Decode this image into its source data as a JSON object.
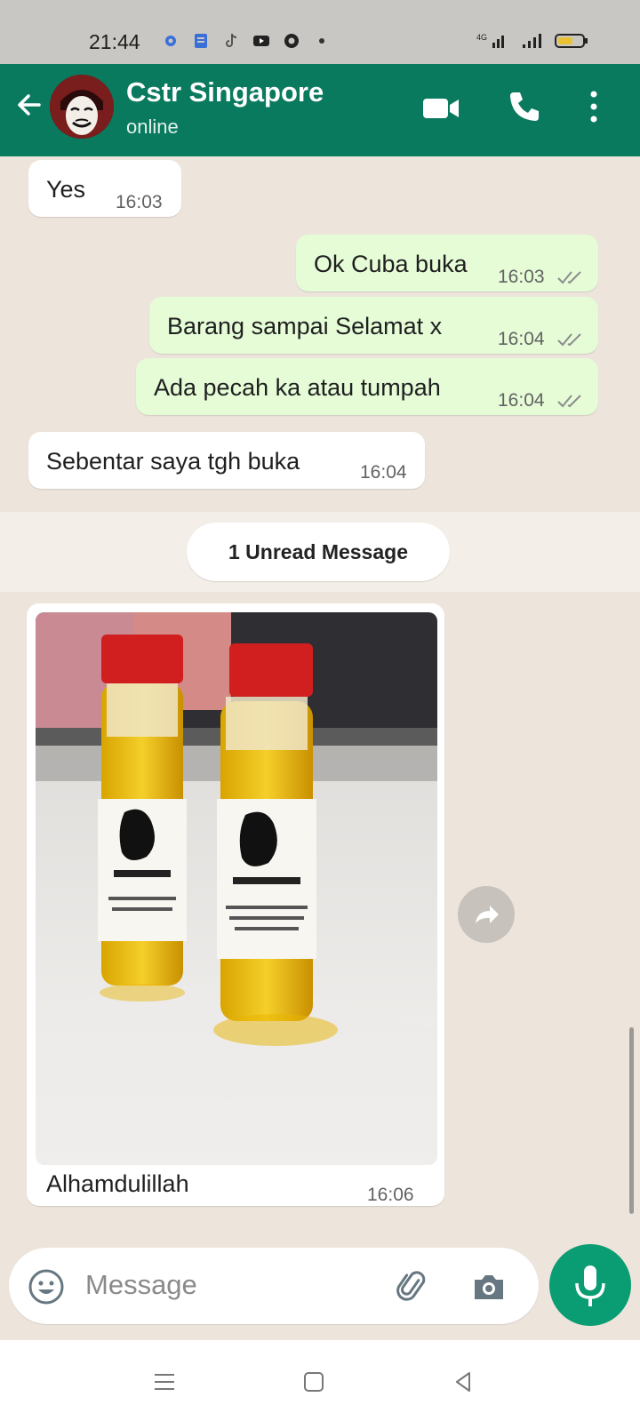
{
  "status_bar": {
    "time": "21:44",
    "network": "4G"
  },
  "header": {
    "contact_name": "Cstr Singapore",
    "status": "online"
  },
  "messages": [
    {
      "dir": "in",
      "text": "Yes",
      "time": "16:03"
    },
    {
      "dir": "out",
      "text": "Ok Cuba buka",
      "time": "16:03"
    },
    {
      "dir": "out",
      "text": "Barang sampai Selamat x",
      "time": "16:04"
    },
    {
      "dir": "out",
      "text": "Ada pecah ka atau tumpah",
      "time": "16:04"
    },
    {
      "dir": "in",
      "text": "Sebentar saya tgh buka",
      "time": "16:04"
    }
  ],
  "unread_label": "1 Unread Message",
  "photo_message": {
    "caption": "Alhamdulillah",
    "time": "16:06",
    "image_subject": "two bottles of yellow oil with red caps"
  },
  "input": {
    "placeholder": "Message"
  },
  "colors": {
    "header": "#0a7a5f",
    "outgoing_bubble": "#e5fcd7",
    "incoming_bubble": "#ffffff",
    "mic_button": "#0a9c72",
    "ticks": "#8c8c8c"
  }
}
